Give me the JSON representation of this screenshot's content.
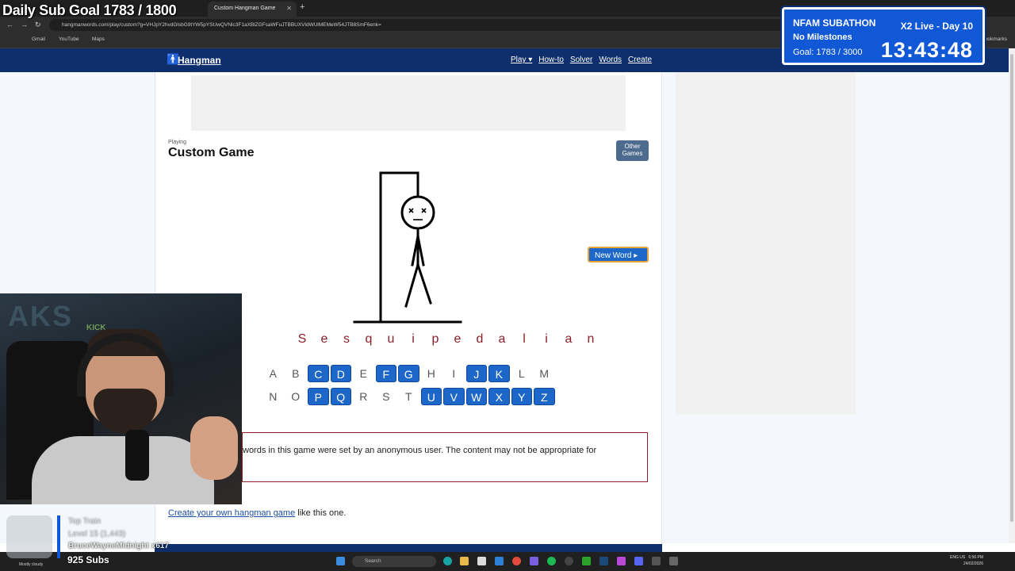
{
  "browser": {
    "tabs": [
      {
        "label": "Custom Hangman Game",
        "active": true
      }
    ],
    "url": "hangmanwords.com/play/custom?g=VHJpY2hvdGlsbG9tYW5pYSUwQVNlc3F1aXBlZGFsaWFuJTBBUXVldWUlMEMeW54JTB8SmF6enk=",
    "bookmarks": [
      "Gmail",
      "YouTube",
      "Maps"
    ],
    "bookmarks_right": "bookmarks"
  },
  "site": {
    "logo": "Hangman",
    "nav": [
      "Play ▾",
      "How-to",
      "Solver",
      "Words",
      "Create"
    ]
  },
  "game": {
    "playing_label": "Playing",
    "title": "Custom Game",
    "other_games_label": "Other Games",
    "new_word_label": "New Word ▸",
    "word_letters": [
      "S",
      "e",
      "s",
      "q",
      "u",
      "i",
      "p",
      "e",
      "d",
      "a",
      "l",
      "i",
      "a",
      "n"
    ],
    "keyboard_row1": [
      {
        "letter": "A",
        "used": false
      },
      {
        "letter": "B",
        "used": false
      },
      {
        "letter": "C",
        "used": true
      },
      {
        "letter": "D",
        "used": true
      },
      {
        "letter": "E",
        "used": false
      },
      {
        "letter": "F",
        "used": true
      },
      {
        "letter": "G",
        "used": true
      },
      {
        "letter": "H",
        "used": false
      },
      {
        "letter": "I",
        "used": false
      },
      {
        "letter": "J",
        "used": true
      },
      {
        "letter": "K",
        "used": true
      },
      {
        "letter": "L",
        "used": false
      },
      {
        "letter": "M",
        "used": false
      }
    ],
    "keyboard_row2": [
      {
        "letter": "N",
        "used": false
      },
      {
        "letter": "O",
        "used": false
      },
      {
        "letter": "P",
        "used": true
      },
      {
        "letter": "Q",
        "used": true
      },
      {
        "letter": "R",
        "used": false
      },
      {
        "letter": "S",
        "used": false
      },
      {
        "letter": "T",
        "used": false
      },
      {
        "letter": "U",
        "used": true
      },
      {
        "letter": "V",
        "used": true
      },
      {
        "letter": "W",
        "used": true
      },
      {
        "letter": "X",
        "used": true
      },
      {
        "letter": "Y",
        "used": true
      },
      {
        "letter": "Z",
        "used": true
      }
    ],
    "notice_text": "words in this game were set by an anonymous user. The content may not be appropriate for",
    "create_link": "Create your own hangman game",
    "create_suffix": " like this one."
  },
  "overlay": {
    "daily_goal": "Daily Sub Goal  1783 / 1800",
    "subathon_name": "NFAM SUBATHON",
    "subathon_live": "X2 Live - Day 10",
    "milestones": "No Milestones",
    "goal": "Goal: 1783 / 3000",
    "timer": "13:43:48",
    "cam_sign": "AKS",
    "cam_kick": "KICK",
    "top_train": "Top Train",
    "train_level": "Level 15  (1,443)",
    "train_user": "BruceWayneMidnight x617",
    "subs": "925 Subs",
    "weather": "Mostly cloudy"
  },
  "taskbar": {
    "search_placeholder": "Search",
    "lang": "ENG US",
    "time": "6:56 PM",
    "date": "24/02/2026"
  }
}
